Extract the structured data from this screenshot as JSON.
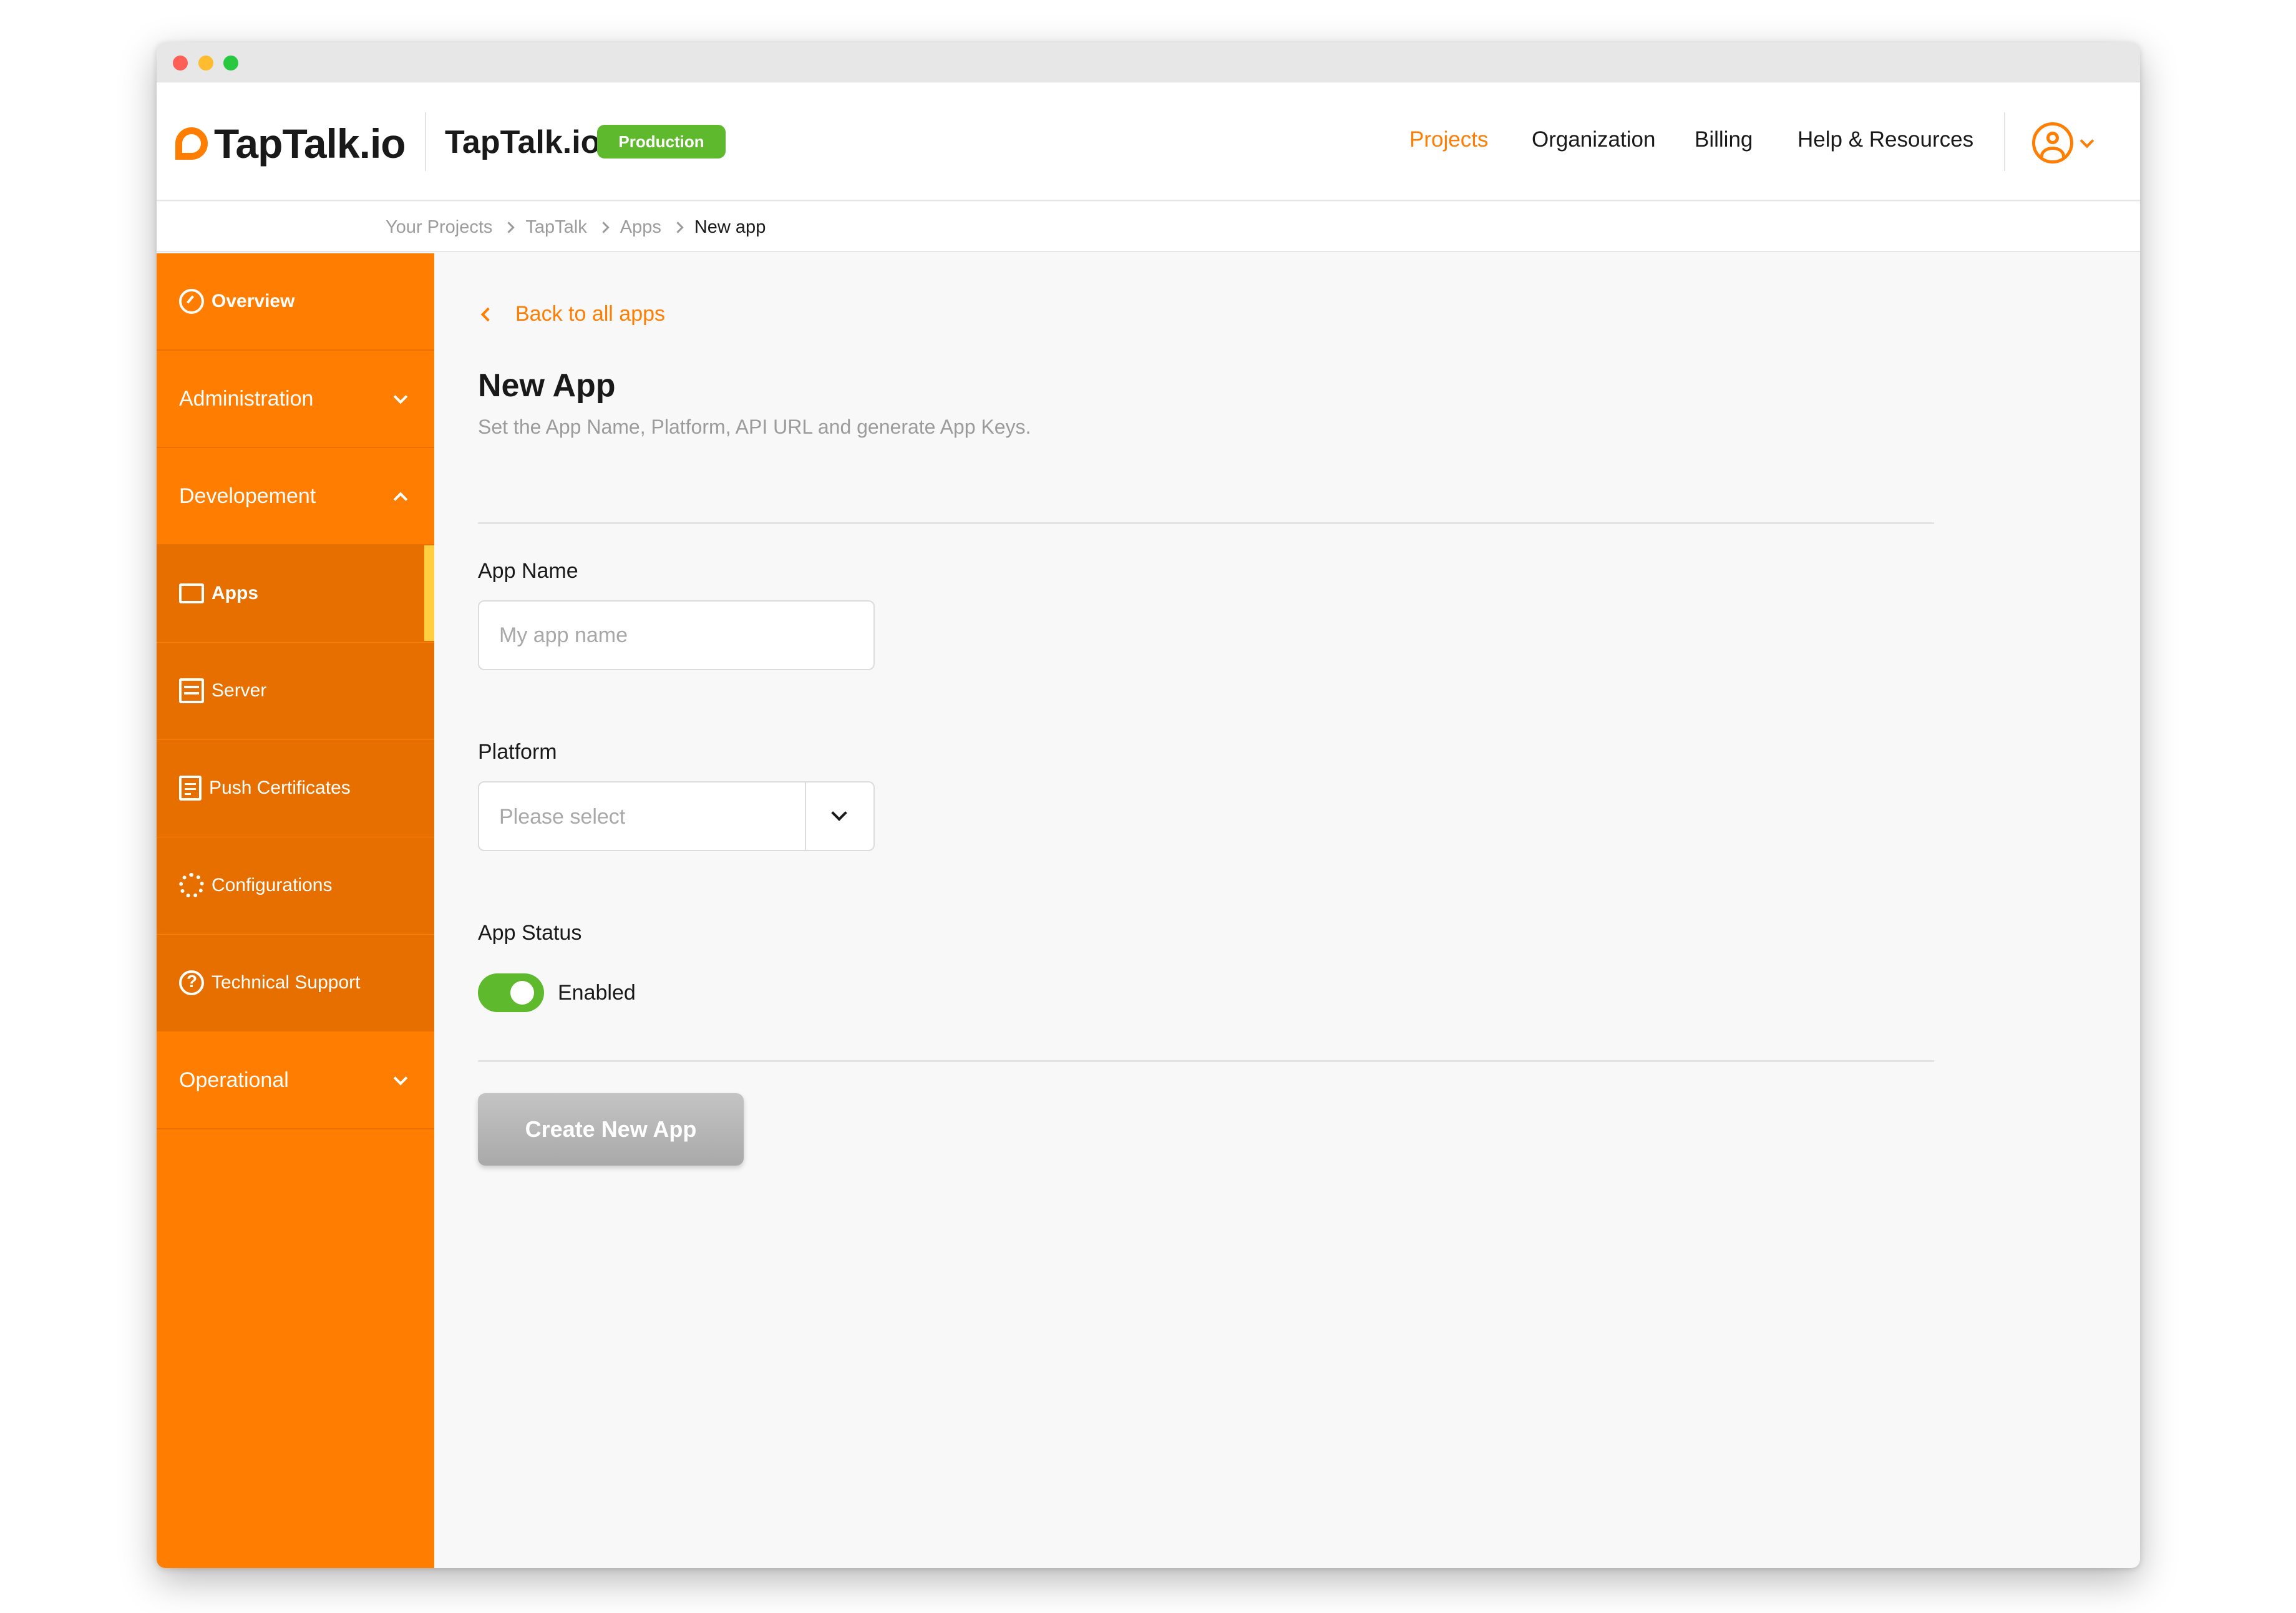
{
  "header": {
    "logo_text": "TapTalk.io",
    "project_name": "TapTalk.io",
    "environment_badge": "Production",
    "menu": {
      "projects": "Projects",
      "organization": "Organization",
      "billing": "Billing",
      "help": "Help & Resources"
    },
    "accent_color": "#ff7d00",
    "badge_color": "#5fb92d"
  },
  "breadcrumb": {
    "items": [
      "Your Projects",
      "TapTalk",
      "Apps",
      "New app"
    ]
  },
  "sidebar": {
    "overview": "Overview",
    "administration": "Administration",
    "development": "Developement",
    "apps": "Apps",
    "server": "Server",
    "push_certificates": "Push Certificates",
    "configurations": "Configurations",
    "technical_support": "Technical Support",
    "operational": "Operational"
  },
  "main": {
    "back_link": "Back to all apps",
    "title": "New App",
    "subtitle": "Set the App Name, Platform, API URL and generate App Keys.",
    "app_name": {
      "label": "App Name",
      "value": "",
      "placeholder": "My app name"
    },
    "platform": {
      "label": "Platform",
      "selected": "Please select"
    },
    "app_status": {
      "label": "App Status",
      "toggle_label": "Enabled",
      "enabled": true
    },
    "create_button": "Create New App"
  }
}
